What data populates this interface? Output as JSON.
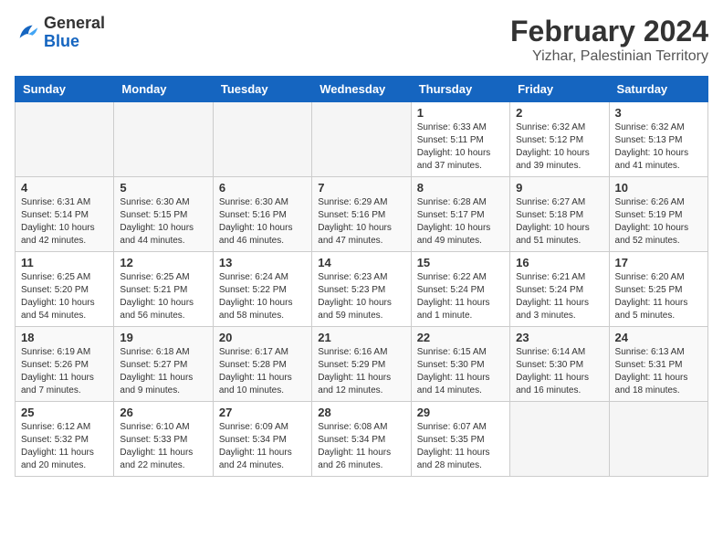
{
  "logo": {
    "general": "General",
    "blue": "Blue"
  },
  "title": "February 2024",
  "subtitle": "Yizhar, Palestinian Territory",
  "days_of_week": [
    "Sunday",
    "Monday",
    "Tuesday",
    "Wednesday",
    "Thursday",
    "Friday",
    "Saturday"
  ],
  "weeks": [
    [
      {
        "day": "",
        "info": ""
      },
      {
        "day": "",
        "info": ""
      },
      {
        "day": "",
        "info": ""
      },
      {
        "day": "",
        "info": ""
      },
      {
        "day": "1",
        "info": "Sunrise: 6:33 AM\nSunset: 5:11 PM\nDaylight: 10 hours and 37 minutes."
      },
      {
        "day": "2",
        "info": "Sunrise: 6:32 AM\nSunset: 5:12 PM\nDaylight: 10 hours and 39 minutes."
      },
      {
        "day": "3",
        "info": "Sunrise: 6:32 AM\nSunset: 5:13 PM\nDaylight: 10 hours and 41 minutes."
      }
    ],
    [
      {
        "day": "4",
        "info": "Sunrise: 6:31 AM\nSunset: 5:14 PM\nDaylight: 10 hours and 42 minutes."
      },
      {
        "day": "5",
        "info": "Sunrise: 6:30 AM\nSunset: 5:15 PM\nDaylight: 10 hours and 44 minutes."
      },
      {
        "day": "6",
        "info": "Sunrise: 6:30 AM\nSunset: 5:16 PM\nDaylight: 10 hours and 46 minutes."
      },
      {
        "day": "7",
        "info": "Sunrise: 6:29 AM\nSunset: 5:16 PM\nDaylight: 10 hours and 47 minutes."
      },
      {
        "day": "8",
        "info": "Sunrise: 6:28 AM\nSunset: 5:17 PM\nDaylight: 10 hours and 49 minutes."
      },
      {
        "day": "9",
        "info": "Sunrise: 6:27 AM\nSunset: 5:18 PM\nDaylight: 10 hours and 51 minutes."
      },
      {
        "day": "10",
        "info": "Sunrise: 6:26 AM\nSunset: 5:19 PM\nDaylight: 10 hours and 52 minutes."
      }
    ],
    [
      {
        "day": "11",
        "info": "Sunrise: 6:25 AM\nSunset: 5:20 PM\nDaylight: 10 hours and 54 minutes."
      },
      {
        "day": "12",
        "info": "Sunrise: 6:25 AM\nSunset: 5:21 PM\nDaylight: 10 hours and 56 minutes."
      },
      {
        "day": "13",
        "info": "Sunrise: 6:24 AM\nSunset: 5:22 PM\nDaylight: 10 hours and 58 minutes."
      },
      {
        "day": "14",
        "info": "Sunrise: 6:23 AM\nSunset: 5:23 PM\nDaylight: 10 hours and 59 minutes."
      },
      {
        "day": "15",
        "info": "Sunrise: 6:22 AM\nSunset: 5:24 PM\nDaylight: 11 hours and 1 minute."
      },
      {
        "day": "16",
        "info": "Sunrise: 6:21 AM\nSunset: 5:24 PM\nDaylight: 11 hours and 3 minutes."
      },
      {
        "day": "17",
        "info": "Sunrise: 6:20 AM\nSunset: 5:25 PM\nDaylight: 11 hours and 5 minutes."
      }
    ],
    [
      {
        "day": "18",
        "info": "Sunrise: 6:19 AM\nSunset: 5:26 PM\nDaylight: 11 hours and 7 minutes."
      },
      {
        "day": "19",
        "info": "Sunrise: 6:18 AM\nSunset: 5:27 PM\nDaylight: 11 hours and 9 minutes."
      },
      {
        "day": "20",
        "info": "Sunrise: 6:17 AM\nSunset: 5:28 PM\nDaylight: 11 hours and 10 minutes."
      },
      {
        "day": "21",
        "info": "Sunrise: 6:16 AM\nSunset: 5:29 PM\nDaylight: 11 hours and 12 minutes."
      },
      {
        "day": "22",
        "info": "Sunrise: 6:15 AM\nSunset: 5:30 PM\nDaylight: 11 hours and 14 minutes."
      },
      {
        "day": "23",
        "info": "Sunrise: 6:14 AM\nSunset: 5:30 PM\nDaylight: 11 hours and 16 minutes."
      },
      {
        "day": "24",
        "info": "Sunrise: 6:13 AM\nSunset: 5:31 PM\nDaylight: 11 hours and 18 minutes."
      }
    ],
    [
      {
        "day": "25",
        "info": "Sunrise: 6:12 AM\nSunset: 5:32 PM\nDaylight: 11 hours and 20 minutes."
      },
      {
        "day": "26",
        "info": "Sunrise: 6:10 AM\nSunset: 5:33 PM\nDaylight: 11 hours and 22 minutes."
      },
      {
        "day": "27",
        "info": "Sunrise: 6:09 AM\nSunset: 5:34 PM\nDaylight: 11 hours and 24 minutes."
      },
      {
        "day": "28",
        "info": "Sunrise: 6:08 AM\nSunset: 5:34 PM\nDaylight: 11 hours and 26 minutes."
      },
      {
        "day": "29",
        "info": "Sunrise: 6:07 AM\nSunset: 5:35 PM\nDaylight: 11 hours and 28 minutes."
      },
      {
        "day": "",
        "info": ""
      },
      {
        "day": "",
        "info": ""
      }
    ]
  ]
}
